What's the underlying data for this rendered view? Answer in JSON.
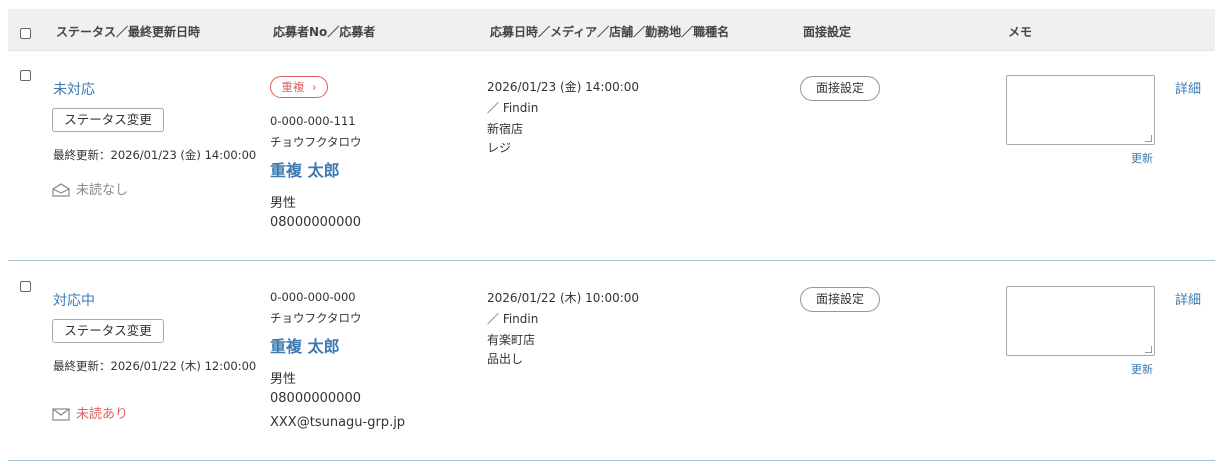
{
  "header": {
    "status_col": "ステータス／最終更新日時",
    "applicant_col": "応募者No／応募者",
    "application_col": "応募日時／メディア／店舗／勤務地／職種名",
    "interview_col": "面接設定",
    "memo_col": "メモ"
  },
  "rows": [
    {
      "status": "未対応",
      "status_button": "ステータス変更",
      "last_update": "最終更新：2026/01/23 (金) 14:00:00",
      "unread_label": "未読なし",
      "unread_color": "#888888",
      "duplicate_badge": "重複",
      "applicant_no": "0-000-000-111",
      "kana": "チョウフクタロウ",
      "name": "重複 太郎",
      "gender": "男性",
      "phone": "08000000000",
      "email": "",
      "applied_at": "2026/01/23 (金) 14:00:00",
      "media": "／ Findin",
      "store": "新宿店",
      "job": "レジ",
      "interview_button": "面接設定",
      "memo_value": "",
      "update_link": "更新",
      "detail_link": "詳細"
    },
    {
      "status": "対応中",
      "status_button": "ステータス変更",
      "last_update": "最終更新：2026/01/22 (木) 12:00:00",
      "unread_label": "未読あり",
      "unread_color": "#e06060",
      "duplicate_badge": "",
      "applicant_no": "0-000-000-000",
      "kana": "チョウフクタロウ",
      "name": "重複 太郎",
      "gender": "男性",
      "phone": "08000000000",
      "email": "XXX@tsunagu-grp.jp",
      "applied_at": "2026/01/22 (木) 10:00:00",
      "media": "／ Findin",
      "store": "有楽町店",
      "job": "品出し",
      "interview_button": "面接設定",
      "memo_value": "",
      "update_link": "更新",
      "detail_link": "詳細"
    }
  ]
}
